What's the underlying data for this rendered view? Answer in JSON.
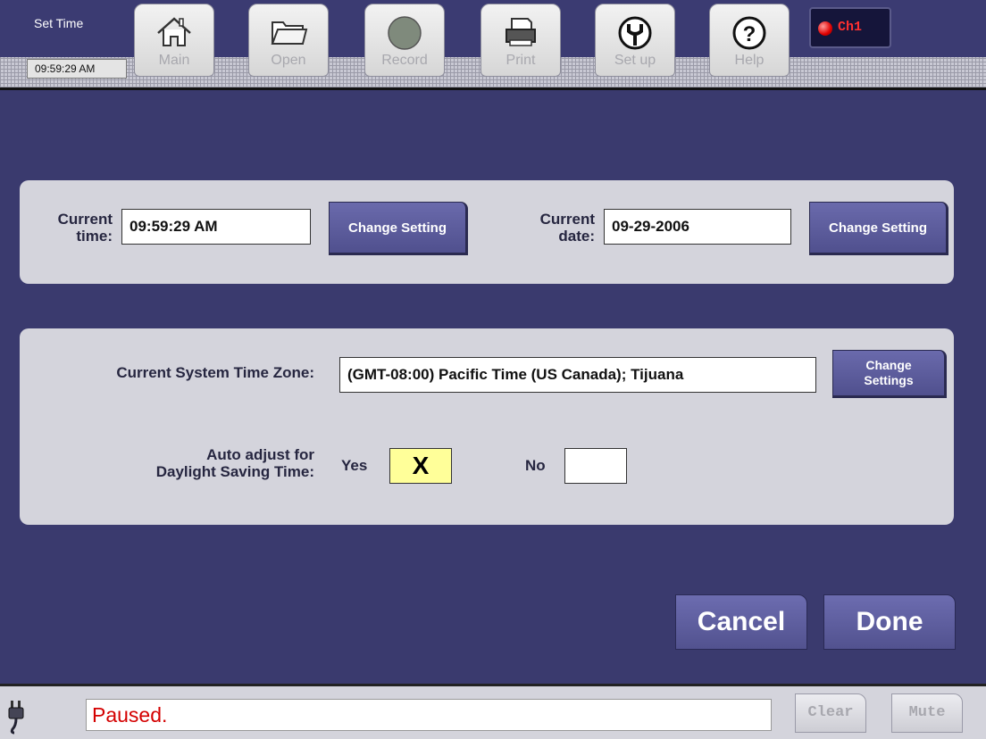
{
  "window": {
    "title": "Set Time",
    "clock": "09:59:29 AM"
  },
  "toolbar": {
    "buttons": [
      {
        "label": "Main",
        "icon": "home-icon"
      },
      {
        "label": "Open",
        "icon": "folder-icon"
      },
      {
        "label": "Record",
        "icon": "record-icon"
      },
      {
        "label": "Print",
        "icon": "printer-icon"
      },
      {
        "label": "Set up",
        "icon": "wrench-icon"
      },
      {
        "label": "Help",
        "icon": "help-icon"
      }
    ],
    "channel": {
      "label": "Ch1",
      "indicator_color": "#e00000"
    }
  },
  "datetime_panel": {
    "time_label": "Current time:",
    "time_label_line1": "Current",
    "time_label_line2": "time:",
    "time_value": "09:59:29 AM",
    "time_button": "Change Setting",
    "date_label_line1": "Current",
    "date_label_line2": "date:",
    "date_value": "09-29-2006",
    "date_button": "Change Setting"
  },
  "timezone_panel": {
    "tz_label": "Current System Time Zone:",
    "tz_value": "(GMT-08:00) Pacific Time (US  Canada); Tijuana",
    "tz_button_line1": "Change",
    "tz_button_line2": "Settings",
    "dst_label_line1": "Auto adjust for",
    "dst_label_line2": "Daylight Saving Time:",
    "yes_label": "Yes",
    "yes_mark": "X",
    "no_label": "No",
    "no_mark": ""
  },
  "actions": {
    "cancel": "Cancel",
    "done": "Done"
  },
  "statusbar": {
    "message": "Paused.",
    "clear": "Clear",
    "mute": "Mute"
  },
  "colors": {
    "background": "#3a3a6e",
    "panel": "#d4d4dc",
    "button": "#5e5e9e",
    "status_text": "#d40000",
    "checkbox_checked": "#ffff99"
  }
}
